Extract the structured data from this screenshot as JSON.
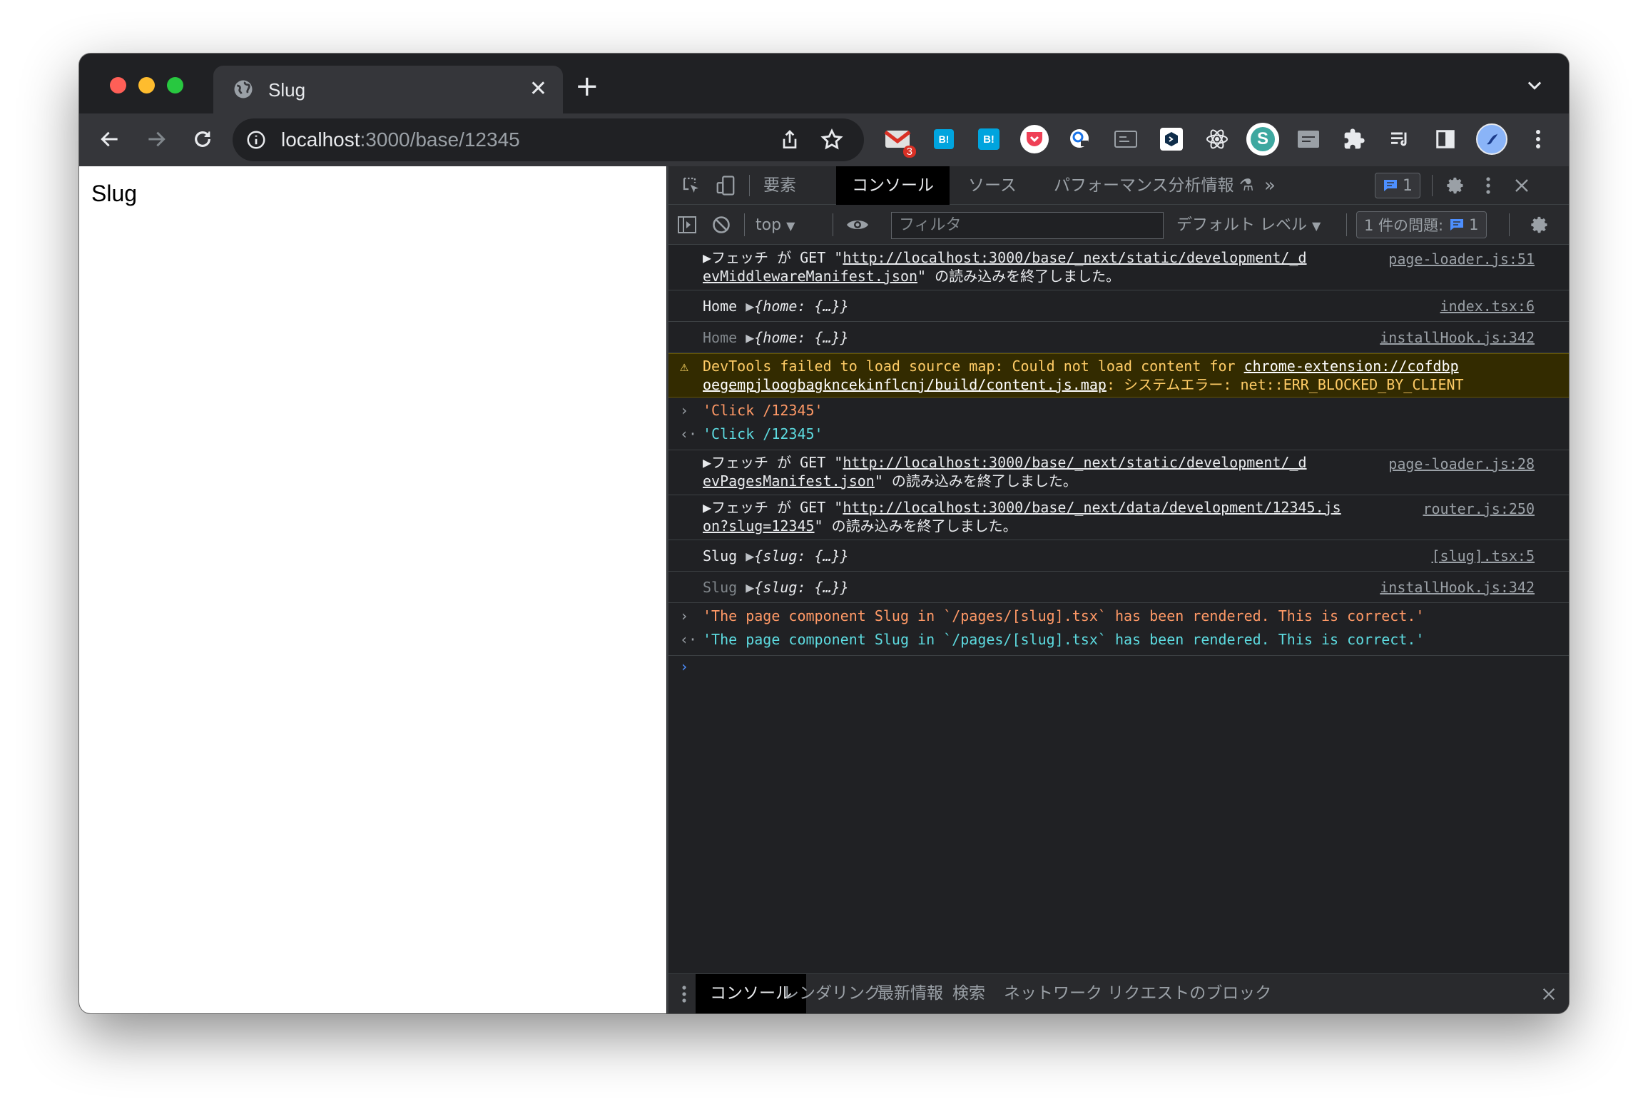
{
  "tab": {
    "title": "Slug",
    "close": "✕"
  },
  "toolbar": {
    "url_host": "localhost",
    "url_path": ":3000/base/12345",
    "gmail_badge": "3"
  },
  "page": {
    "heading": "Slug"
  },
  "devtools": {
    "tabs": [
      "要素",
      "コンソール",
      "ソース",
      "パフォーマンス分析情報"
    ],
    "more": "»",
    "issue_count_top": "1",
    "context": "top",
    "filter_placeholder": "フィルタ",
    "level": "デフォルト レベル",
    "issues_label": "1 件の問題:",
    "issues_count": "1"
  },
  "console": {
    "fetch1": {
      "pre": "▶フェッチ が GET \"",
      "url": "http://localhost:3000/base/_next/static/development/_d",
      "url2": "evMiddlewareManifest.json",
      "post": "\" の読み込みを終了しました。",
      "src": "page-loader.js:51"
    },
    "home1": {
      "label": "Home",
      "obj": "{home: {…}}",
      "src": "index.tsx:6"
    },
    "home2": {
      "label": "Home",
      "obj": "{home: {…}}",
      "src": "installHook.js:342"
    },
    "warn": {
      "pre": "DevTools failed to load source map: Could not load content for ",
      "url": "chrome-extension://cofdbp",
      "url2": "oegempjloogbagkncekinflcnj/build/content.js.map",
      "post": ": システムエラー: net::ERR_BLOCKED_BY_CLIENT"
    },
    "click_in": "'Click /12345'",
    "click_out": "'Click /12345'",
    "fetch2": {
      "pre": "▶フェッチ が GET \"",
      "url": "http://localhost:3000/base/_next/static/development/_d",
      "url2": "evPagesManifest.json",
      "post": "\" の読み込みを終了しました。",
      "src": "page-loader.js:28"
    },
    "fetch3": {
      "pre": "▶フェッチ が GET \"",
      "url": "http://localhost:3000/base/_next/data/development/12345.js",
      "url2": "on?slug=12345",
      "post": "\" の読み込みを終了しました。",
      "src": "router.js:250"
    },
    "slug1": {
      "label": "Slug",
      "obj": "{slug: {…}}",
      "src": "[slug].tsx:5"
    },
    "slug2": {
      "label": "Slug",
      "obj": "{slug: {…}}",
      "src": "installHook.js:342"
    },
    "rendered_in": "'The page component Slug in `/pages/[slug].tsx` has been rendered. This is correct.'",
    "rendered_out": "'The page component Slug in `/pages/[slug].tsx` has been rendered. This is correct.'"
  },
  "drawer": {
    "tabs": [
      "コンソール",
      "レンダリング",
      "最新情報",
      "検索",
      "ネットワーク リクエストのブロック"
    ]
  }
}
